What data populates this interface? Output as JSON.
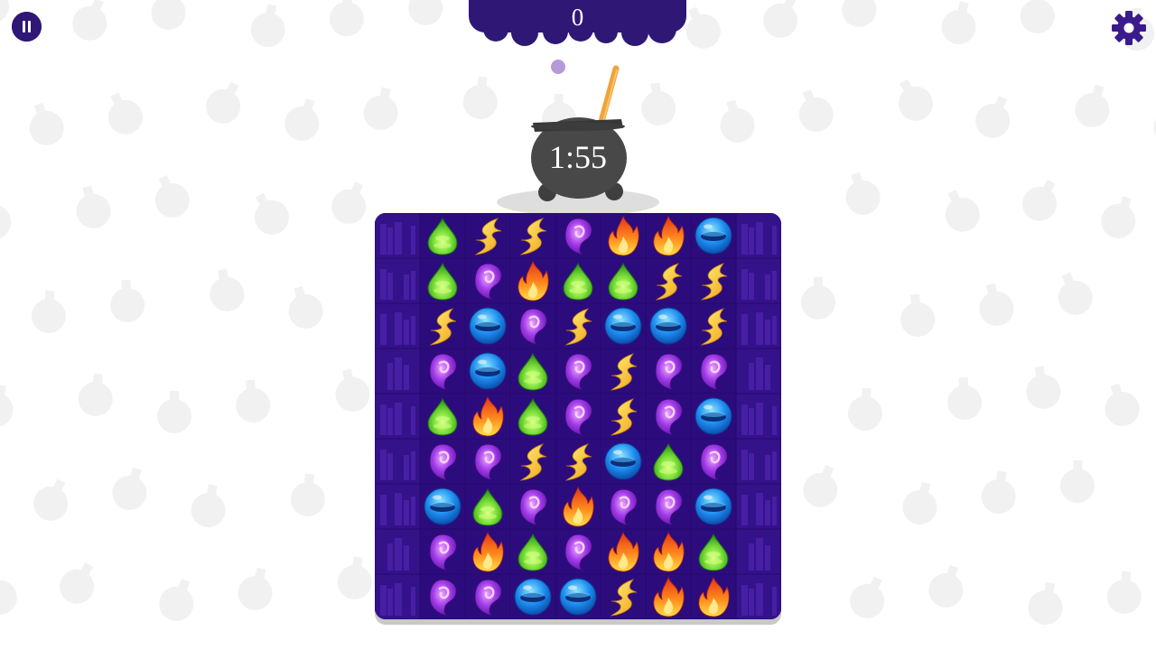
{
  "hud": {
    "score": "0",
    "timer": "1:55"
  },
  "colors": {
    "background": "#ffffff",
    "board": "#2b0c7a",
    "board_side": "#3a1a8c",
    "hud_purple": "#2f1776",
    "settings_purple": "#3b1b8c",
    "cauldron": "#4a4a4a",
    "spoon": "#f0a33a"
  },
  "gem_types": {
    "G": "green-potion-drop",
    "Y": "yellow-lightning-swirl",
    "P": "purple-swirl-drop",
    "F": "orange-fire-flame",
    "B": "blue-water-orb"
  },
  "board": {
    "rows": [
      [
        "",
        "G",
        "Y",
        "Y",
        "P",
        "F",
        "F",
        "B",
        ""
      ],
      [
        "",
        "G",
        "P",
        "F",
        "G",
        "G",
        "Y",
        "Y",
        ""
      ],
      [
        "",
        "Y",
        "B",
        "P",
        "Y",
        "B",
        "B",
        "Y",
        ""
      ],
      [
        "",
        "P",
        "B",
        "G",
        "P",
        "Y",
        "P",
        "P",
        ""
      ],
      [
        "",
        "G",
        "F",
        "G",
        "P",
        "Y",
        "P",
        "B",
        ""
      ],
      [
        "",
        "P",
        "P",
        "Y",
        "Y",
        "B",
        "G",
        "P",
        ""
      ],
      [
        "",
        "B",
        "G",
        "P",
        "F",
        "P",
        "P",
        "B",
        ""
      ],
      [
        "",
        "P",
        "F",
        "G",
        "P",
        "F",
        "F",
        "G",
        ""
      ],
      [
        "",
        "P",
        "P",
        "B",
        "B",
        "Y",
        "F",
        "F",
        ""
      ]
    ]
  }
}
